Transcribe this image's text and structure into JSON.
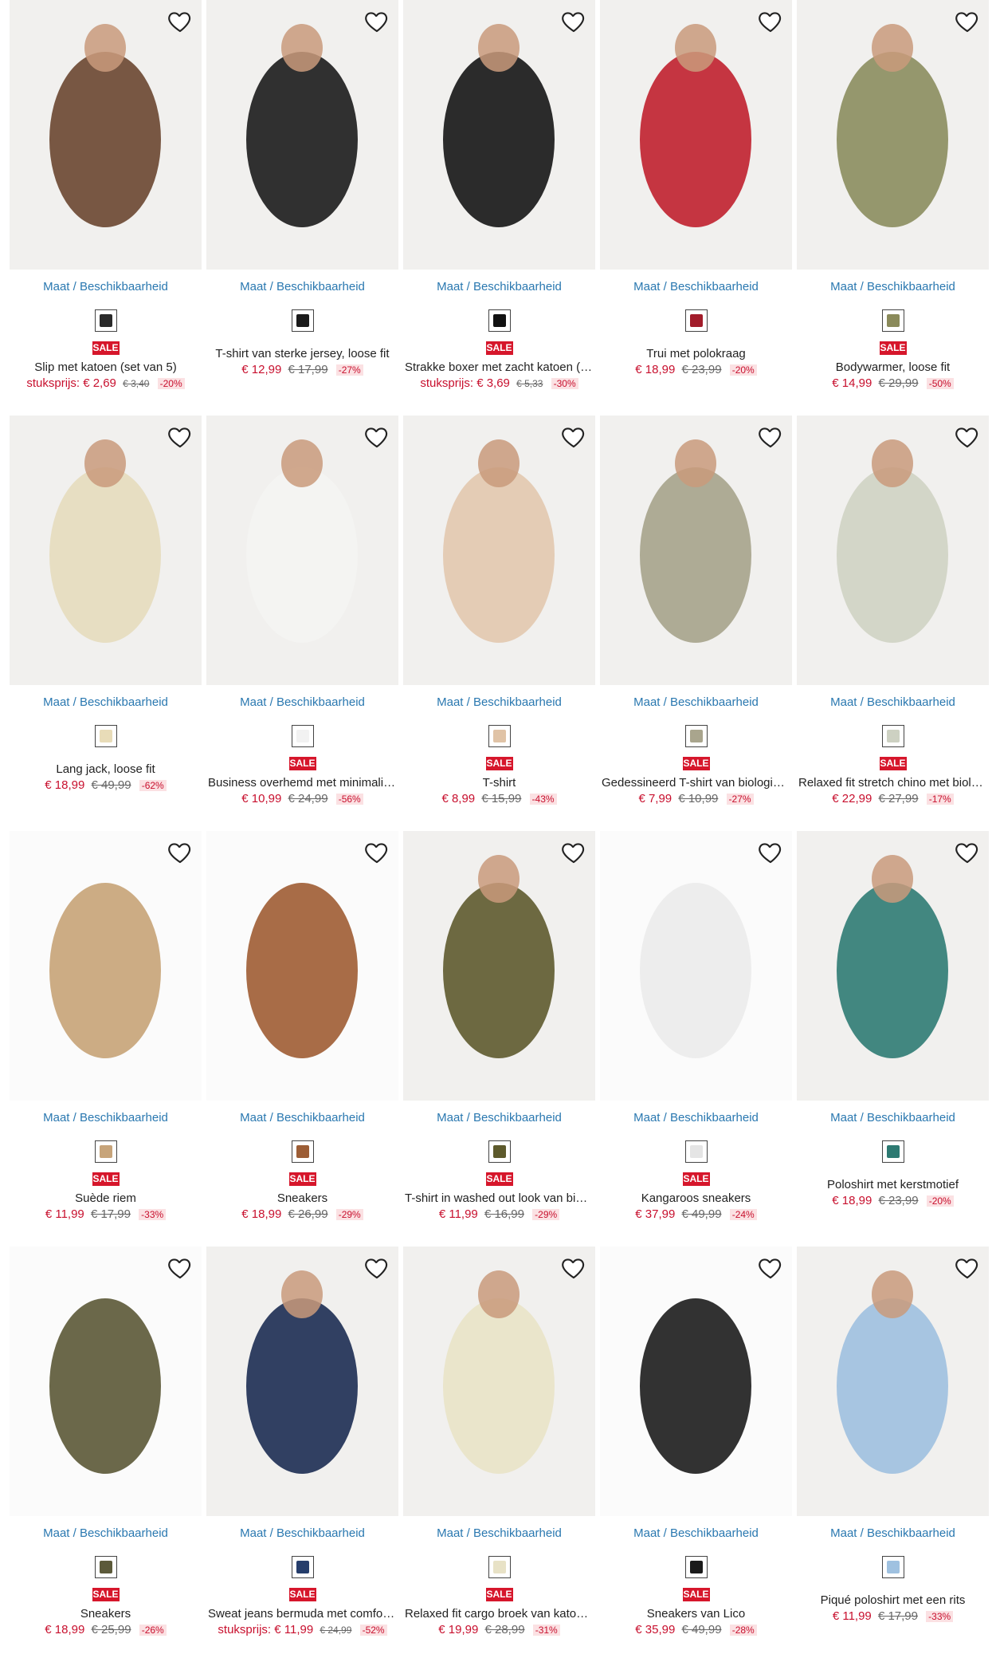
{
  "size_link_label": "Maat / Beschikbaarheid",
  "sale_label": "SALE",
  "colors": {
    "accent": "#2a78b0",
    "sale": "#d6162b",
    "price": "#c8102e"
  },
  "products": [
    {
      "title": "Slip met katoen (set van 5)",
      "price": "stuksprijs: € 2,69",
      "old": "€ 3,40",
      "pct": "-20%",
      "sale": true,
      "thumb": "#2a2a2a",
      "img": "#6a4630",
      "bg": "#f1f0ee"
    },
    {
      "title": "T-shirt van sterke jersey, loose fit",
      "price": "€ 12,99",
      "old": "€ 17,99",
      "pct": "-27%",
      "sale": false,
      "thumb": "#1a1a1a",
      "img": "#1b1b1b",
      "bg": "#f1f0ee"
    },
    {
      "title": "Strakke boxer met zacht katoen (s...",
      "price": "stuksprijs: € 3,69",
      "old": "€ 5,33",
      "pct": "-30%",
      "sale": true,
      "thumb": "#111111",
      "img": "#151515",
      "bg": "#f1f0ee"
    },
    {
      "title": "Trui met polokraag",
      "price": "€ 18,99",
      "old": "€ 23,99",
      "pct": "-20%",
      "sale": false,
      "thumb": "#a21c2a",
      "img": "#c0202e",
      "bg": "#f1f0ee"
    },
    {
      "title": "Bodywarmer, loose fit",
      "price": "€ 14,99",
      "old": "€ 29,99",
      "pct": "-50%",
      "sale": true,
      "thumb": "#8a8a5a",
      "img": "#8b8d5e",
      "bg": "#f1f0ee"
    },
    {
      "title": "Lang jack, loose fit",
      "price": "€ 18,99",
      "old": "€ 49,99",
      "pct": "-62%",
      "sale": false,
      "thumb": "#e8dcb8",
      "img": "#e6dcbd",
      "bg": "#f1f0ee"
    },
    {
      "title": "Business overhemd met minimalisti...",
      "price": "€ 10,99",
      "old": "€ 24,99",
      "pct": "-56%",
      "sale": true,
      "thumb": "#f2f2f2",
      "img": "#f4f4f2",
      "bg": "#f1f0ee"
    },
    {
      "title": "T-shirt",
      "price": "€ 8,99",
      "old": "€ 15,99",
      "pct": "-43%",
      "sale": true,
      "thumb": "#e0c3a6",
      "img": "#e2c8ae",
      "bg": "#f1f0ee"
    },
    {
      "title": "Gedessineerd T-shirt van biologisch...",
      "price": "€ 7,99",
      "old": "€ 10,99",
      "pct": "-27%",
      "sale": true,
      "thumb": "#a9a58d",
      "img": "#a6a38b",
      "bg": "#f1f0ee"
    },
    {
      "title": "Relaxed fit stretch chino met biolo...",
      "price": "€ 22,99",
      "old": "€ 27,99",
      "pct": "-17%",
      "sale": true,
      "thumb": "#cdd1c2",
      "img": "#cfd3c3",
      "bg": "#f1f0ee"
    },
    {
      "title": "Suède riem",
      "price": "€ 11,99",
      "old": "€ 17,99",
      "pct": "-33%",
      "sale": true,
      "thumb": "#c7a47a",
      "img": "#c6a377",
      "bg": "#fbfbfb"
    },
    {
      "title": "Sneakers",
      "price": "€ 18,99",
      "old": "€ 26,99",
      "pct": "-29%",
      "sale": true,
      "thumb": "#9c5d35",
      "img": "#9e5c33",
      "bg": "#fbfbfb"
    },
    {
      "title": "T-shirt in washed out look van biolo...",
      "price": "€ 11,99",
      "old": "€ 16,99",
      "pct": "-29%",
      "sale": true,
      "thumb": "#5d5a2c",
      "img": "#5e5a2e",
      "bg": "#f1f0ee"
    },
    {
      "title": "Kangaroos sneakers",
      "price": "€ 37,99",
      "old": "€ 49,99",
      "pct": "-24%",
      "sale": true,
      "thumb": "#e5e5e5",
      "img": "#ebebeb",
      "bg": "#fbfbfb"
    },
    {
      "title": "Poloshirt met kerstmotief",
      "price": "€ 18,99",
      "old": "€ 23,99",
      "pct": "-20%",
      "sale": false,
      "thumb": "#2d7a72",
      "img": "#2f7b73",
      "bg": "#f1f0ee"
    },
    {
      "title": "Sneakers",
      "price": "€ 18,99",
      "old": "€ 25,99",
      "pct": "-26%",
      "sale": true,
      "thumb": "#5c5a3a",
      "img": "#5b5836",
      "bg": "#fbfbfb"
    },
    {
      "title": "Sweat jeans bermuda met comfort...",
      "price": "stuksprijs: € 11,99",
      "old": "€ 24,99",
      "pct": "-52%",
      "sale": true,
      "thumb": "#253d6b",
      "img": "#1c2c52",
      "bg": "#f1f0ee"
    },
    {
      "title": "Relaxed fit cargo broek van katoen...",
      "price": "€ 19,99",
      "old": "€ 28,99",
      "pct": "-31%",
      "sale": true,
      "thumb": "#e8e2c6",
      "img": "#e9e3c7",
      "bg": "#f1f0ee"
    },
    {
      "title": "Sneakers van Lico",
      "price": "€ 35,99",
      "old": "€ 49,99",
      "pct": "-28%",
      "sale": true,
      "thumb": "#1a1a1a",
      "img": "#1c1c1c",
      "bg": "#fbfbfb"
    },
    {
      "title": "Piqué poloshirt met een rits",
      "price": "€ 11,99",
      "old": "€ 17,99",
      "pct": "-33%",
      "sale": false,
      "thumb": "#9fc1e0",
      "img": "#9fc0df",
      "bg": "#f1f0ee"
    }
  ]
}
